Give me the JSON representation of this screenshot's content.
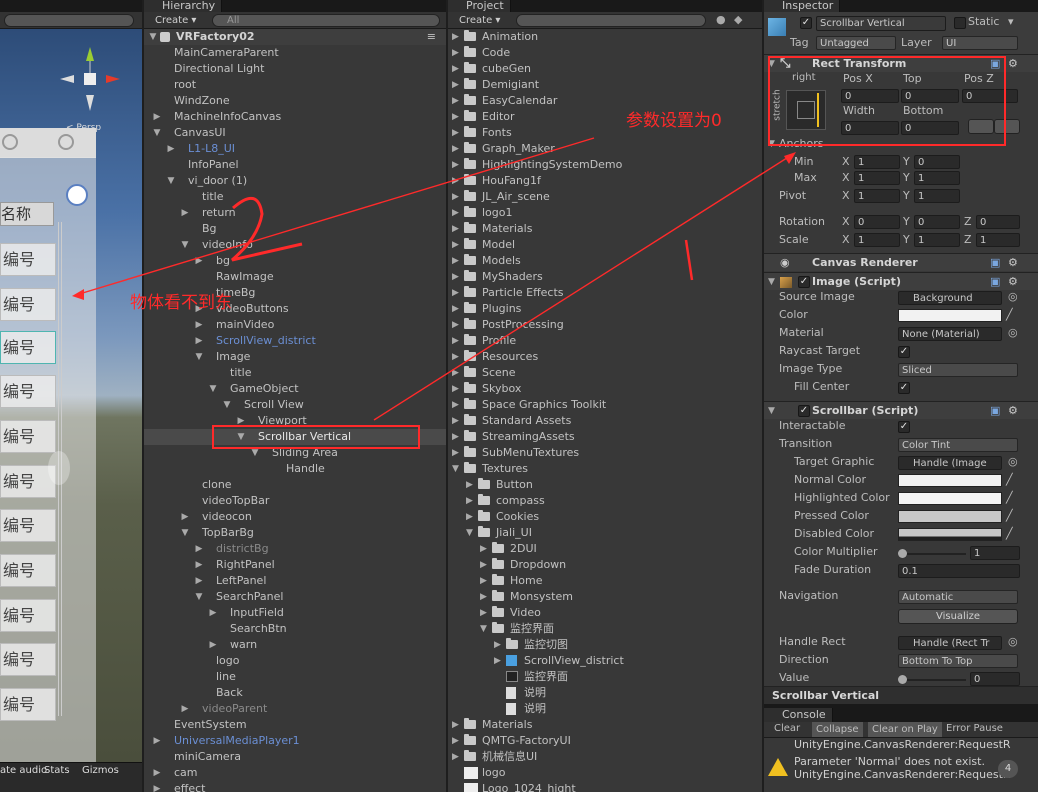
{
  "scene": {
    "persp_label": "< Persp",
    "cell_text": [
      "名称",
      "编号",
      "编号",
      "编号",
      "编号",
      "编号",
      "编号",
      "编号",
      "编号",
      "编号",
      "编号",
      "编号"
    ],
    "bottom_items": [
      "ate audio",
      "Stats",
      "Gizmos"
    ]
  },
  "hierarchy": {
    "tab": "Hierarchy",
    "create": "Create",
    "search_placeholder": "All",
    "scene_name": "VRFactory02",
    "rows": [
      "MainCameraParent",
      "Directional Light",
      "root",
      "WindZone",
      "MachineInfoCanvas",
      "CanvasUI",
      "L1-L8_UI",
      "InfoPanel",
      "vi_door (1)",
      "title",
      "return",
      "Bg",
      "videoInfo",
      "bg",
      "RawImage",
      "timeBg",
      "videoButtons",
      "mainVideo",
      "ScrollView_district",
      "Image",
      "title",
      "GameObject",
      "Scroll View",
      "Viewport",
      "Scrollbar Vertical",
      "Sliding Area",
      "Handle",
      "clone",
      "videoTopBar",
      "videocon",
      "TopBarBg",
      "districtBg",
      "RightPanel",
      "LeftPanel",
      "SearchPanel",
      "InputField",
      "SearchBtn",
      "warn",
      "logo",
      "line",
      "Back",
      "videoParent",
      "EventSystem",
      "UniversalMediaPlayer1",
      "miniCamera",
      "cam",
      "effect"
    ]
  },
  "project": {
    "tab": "Project",
    "create": "Create",
    "rows": [
      "Animation",
      "Code",
      "cubeGen",
      "Demigiant",
      "EasyCalendar",
      "Editor",
      "Fonts",
      "Graph_Maker",
      "HighlightingSystemDemo",
      "HouFang1f",
      "JL_Air_scene",
      "logo1",
      "Materials",
      "Model",
      "Models",
      "MyShaders",
      "Particle Effects",
      "Plugins",
      "PostProcessing",
      "Profile",
      "Resources",
      "Scene",
      "Skybox",
      "Space Graphics Toolkit",
      "Standard Assets",
      "StreamingAssets",
      "SubMenuTextures",
      "Textures",
      "Button",
      "compass",
      "Cookies",
      "Jiali_UI",
      "2DUI",
      "Dropdown",
      "Home",
      "Monsystem",
      "Video",
      "监控界面",
      "监控切图",
      "ScrollView_district",
      "监控界面",
      "说明",
      "说明",
      "Materials",
      "QMTG-FactoryUI",
      "机械信息UI",
      "logo",
      "Logo_1024_hight"
    ]
  },
  "inspector": {
    "tab": "Inspector",
    "object_name": "Scrollbar Vertical",
    "static_label": "Static",
    "tag_label": "Tag",
    "tag_value": "Untagged",
    "layer_label": "Layer",
    "layer_value": "UI",
    "rect_transform": {
      "title": "Rect Transform",
      "anchor_h": "right",
      "anchor_v": "stretch",
      "pos_x_label": "Pos X",
      "top_label": "Top",
      "pos_z_label": "Pos Z",
      "pos_x": "0",
      "top": "0",
      "pos_z": "0",
      "width_label": "Width",
      "bottom_label": "Bottom",
      "width": "0",
      "bottom": "0",
      "anchors_label": "Anchors",
      "min_label": "Min",
      "max_label": "Max",
      "pivot_label": "Pivot",
      "min_x": "1",
      "min_y": "0",
      "max_x": "1",
      "max_y": "1",
      "pivot_x": "1",
      "pivot_y": "1",
      "rotation_label": "Rotation",
      "scale_label": "Scale",
      "rot_x": "0",
      "rot_y": "0",
      "rot_z": "0",
      "scale_x": "1",
      "scale_y": "1",
      "scale_z": "1",
      "x": "X",
      "y": "Y",
      "z": "Z"
    },
    "canvas_renderer": "Canvas Renderer",
    "image": {
      "title": "Image (Script)",
      "source_image_label": "Source Image",
      "source_image": "Background",
      "color_label": "Color",
      "material_label": "Material",
      "material": "None (Material)",
      "raycast_label": "Raycast Target",
      "image_type_label": "Image Type",
      "image_type": "Sliced",
      "fill_center_label": "Fill Center"
    },
    "scrollbar": {
      "title": "Scrollbar (Script)",
      "interactable_label": "Interactable",
      "transition_label": "Transition",
      "transition": "Color Tint",
      "target_graphic_label": "Target Graphic",
      "target_graphic": "Handle (Image",
      "normal_color_label": "Normal Color",
      "highlighted_color_label": "Highlighted Color",
      "pressed_color_label": "Pressed Color",
      "disabled_color_label": "Disabled Color",
      "color_multiplier_label": "Color Multiplier",
      "color_multiplier": "1",
      "fade_duration_label": "Fade Duration",
      "fade_duration": "0.1",
      "navigation_label": "Navigation",
      "navigation": "Automatic",
      "visualize": "Visualize",
      "handle_rect_label": "Handle Rect",
      "handle_rect": "Handle (Rect Tr",
      "direction_label": "Direction",
      "direction": "Bottom To Top",
      "value_label": "Value",
      "value": "0"
    },
    "footer_title": "Scrollbar Vertical"
  },
  "console": {
    "tab": "Console",
    "buttons": [
      "Clear",
      "Collapse",
      "Clear on Play",
      "Error Pause"
    ],
    "lines": [
      "UnityEngine.CanvasRenderer:RequestR",
      "Parameter 'Normal' does not exist.",
      "UnityEngine.CanvasRenderer:RequestR"
    ],
    "count": "4"
  },
  "annotations": {
    "params_zero": "参数设置为0",
    "object_invisible": "物体看不到东",
    "number_two": "2",
    "number_one": "1"
  },
  "colors": {
    "annotation_red": "#ff2a2a",
    "link_blue": "#6b8fd4",
    "panel_bg": "#383838"
  }
}
